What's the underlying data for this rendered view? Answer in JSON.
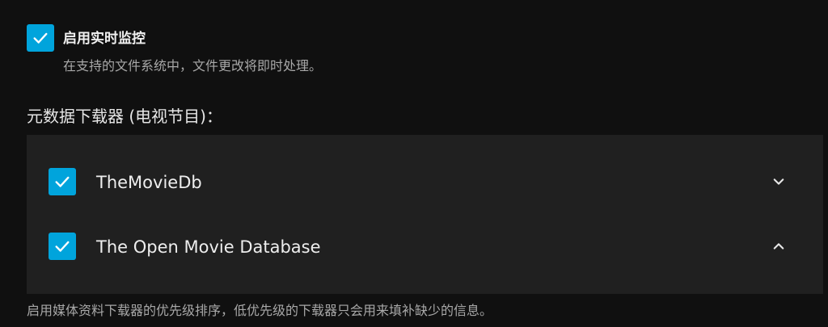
{
  "realtime_monitoring": {
    "label": "启用实时监控",
    "checked": true,
    "description": "在支持的文件系统中，文件更改将即时处理。"
  },
  "metadata_fetchers": {
    "title": "元数据下载器 (电视节目)：",
    "items": [
      {
        "name": "TheMovieDb",
        "checked": true,
        "chevron": "chevron-down-icon"
      },
      {
        "name": "The Open Movie Database",
        "checked": true,
        "chevron": "chevron-up-icon"
      }
    ],
    "footer": "启用媒体资料下载器的优先级排序，低优先级的下载器只会用来填补缺少的信息。"
  },
  "colors": {
    "accent": "#00a4dc",
    "background": "#101010",
    "panel": "#202020"
  }
}
